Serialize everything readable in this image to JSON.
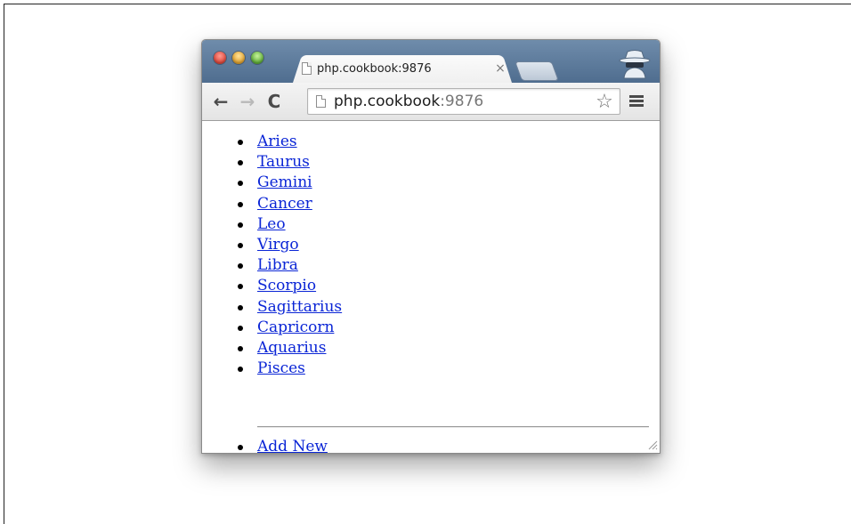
{
  "browser": {
    "tab_title": "php.cookbook:9876",
    "tab_close": "×",
    "url_host": "php.cookbook",
    "url_port": ":9876",
    "star_glyph": "☆"
  },
  "signs": [
    "Aries",
    "Taurus",
    "Gemini",
    "Cancer",
    "Leo",
    "Virgo",
    "Libra",
    "Scorpio",
    "Sagittarius",
    "Capricorn",
    "Aquarius",
    "Pisces"
  ],
  "actions": {
    "add_new": "Add New"
  },
  "colors": {
    "link": "#0a25d6",
    "titlebar": "#5a7798",
    "close_button": "#e0463a",
    "minimize_button": "#e2a22c",
    "zoom_button": "#5eae36"
  }
}
